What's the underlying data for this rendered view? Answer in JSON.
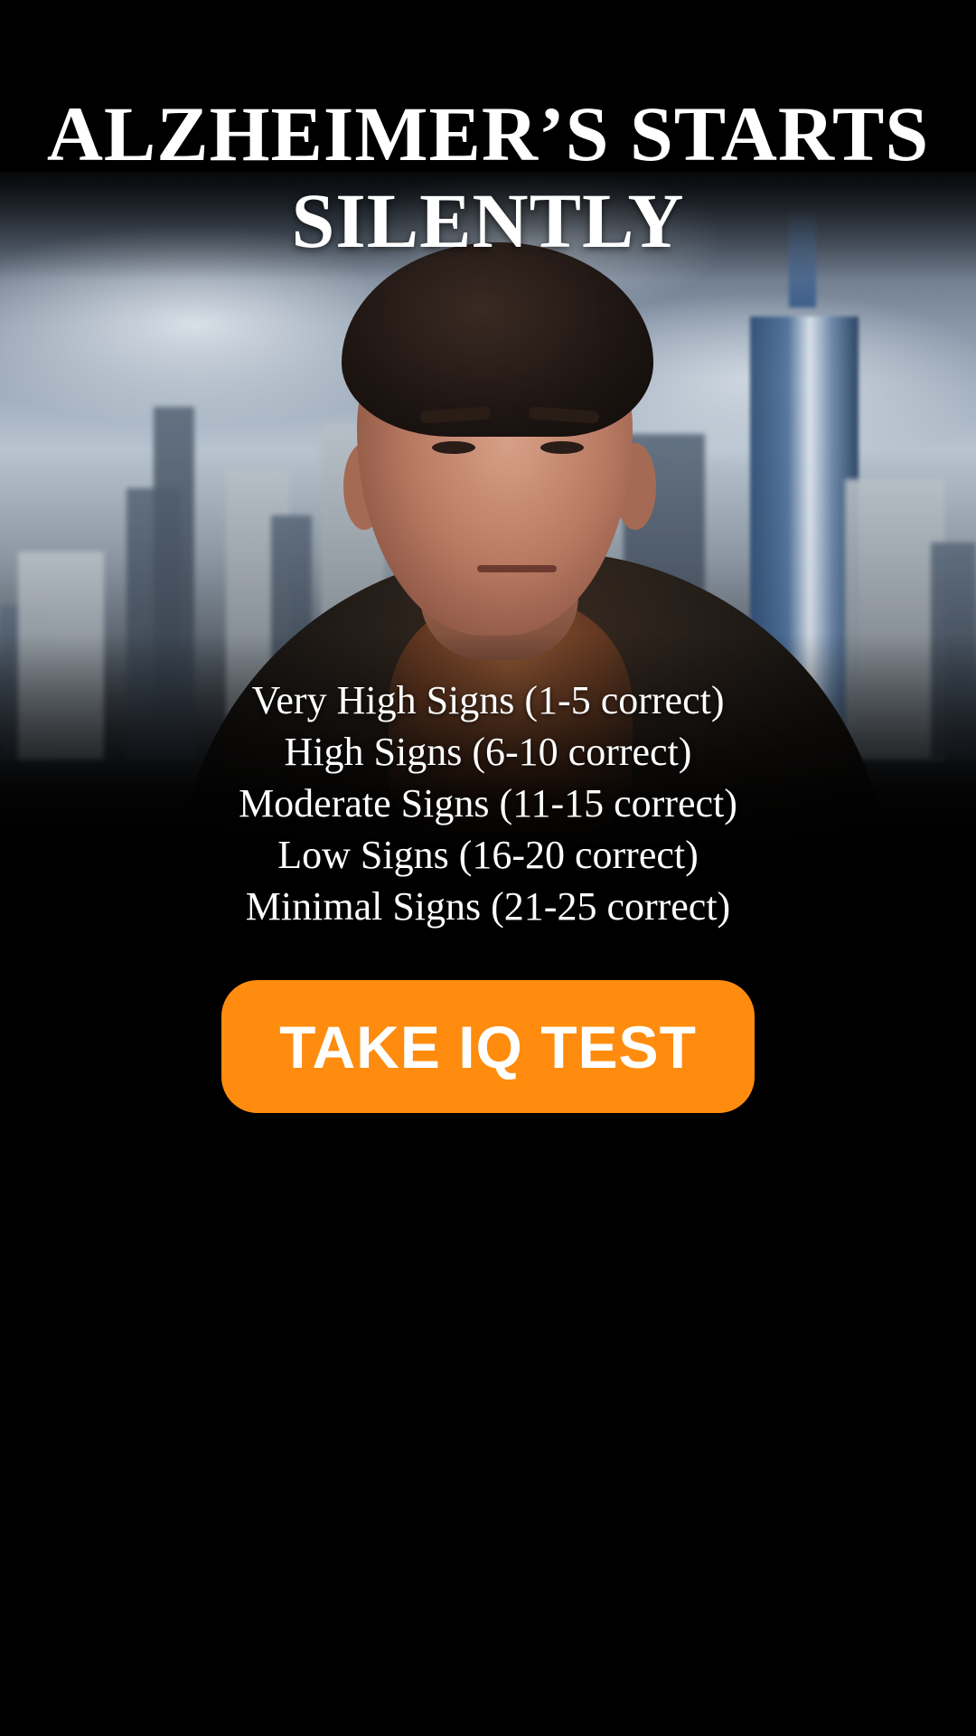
{
  "headline": {
    "line1": "ALZHEIMER’S STARTS",
    "line2": "SILENTLY"
  },
  "score_ranges": [
    {
      "label": "Very High Signs  (1-5 correct)"
    },
    {
      "label": "High Signs  (6-10 correct)"
    },
    {
      "label": "Moderate Signs  (11-15 correct)"
    },
    {
      "label": "Low Signs  (16-20 correct)"
    },
    {
      "label": "Minimal Signs  (21-25 correct)"
    }
  ],
  "cta": {
    "label": "TAKE IQ TEST"
  },
  "colors": {
    "background": "#000000",
    "cta_background": "#ff8c0e",
    "text": "#ffffff"
  }
}
